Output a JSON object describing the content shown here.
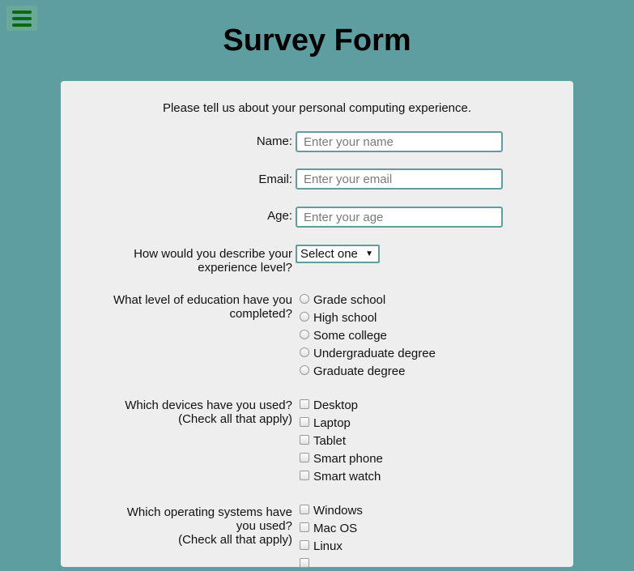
{
  "header": {
    "title": "Survey Form"
  },
  "form": {
    "intro": "Please tell us about your personal computing experience.",
    "name": {
      "label": "Name:",
      "placeholder": "Enter your name",
      "value": ""
    },
    "email": {
      "label": "Email:",
      "placeholder": "Enter your email",
      "value": ""
    },
    "age": {
      "label": "Age:",
      "placeholder": "Enter your age",
      "value": ""
    },
    "experience": {
      "label_line1": "How would you describe your",
      "label_line2": "experience level?",
      "selected": "Select one"
    },
    "education": {
      "label_line1": "What level of education have you",
      "label_line2": "completed?",
      "options": [
        "Grade school",
        "High school",
        "Some college",
        "Undergraduate degree",
        "Graduate degree"
      ]
    },
    "devices": {
      "label_line1": "Which devices have you used?",
      "label_line2": "(Check all that apply)",
      "options": [
        "Desktop",
        "Laptop",
        "Tablet",
        "Smart phone",
        "Smart watch"
      ]
    },
    "os": {
      "label_line1": "Which operating systems have",
      "label_line2": "you used?",
      "label_line3": "(Check all that apply)",
      "options": [
        "Windows",
        "Mac OS",
        "Linux"
      ]
    }
  },
  "colors": {
    "background": "#5f9ea0",
    "card": "#eeeeee",
    "menu_icon": "#0a6b0a",
    "input_border": "#5f9ea0"
  },
  "icons": {
    "menu": "hamburger-menu-icon",
    "dropdown": "triangle-down-icon"
  }
}
